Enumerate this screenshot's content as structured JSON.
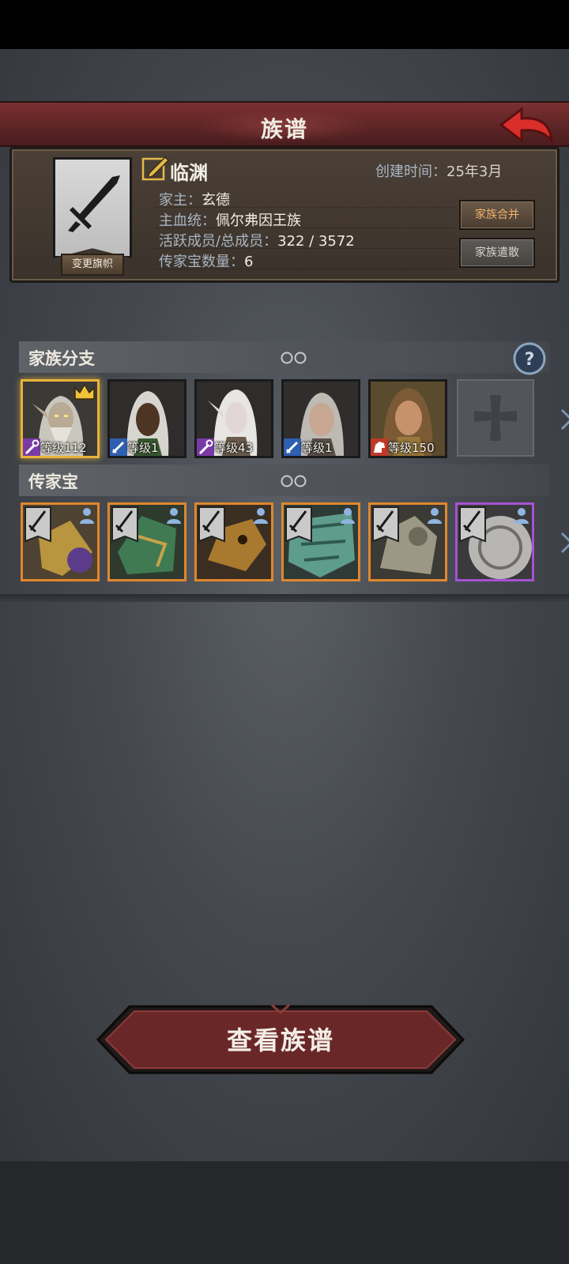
{
  "header": {
    "title": "族谱",
    "back_icon": "back-arrow-icon"
  },
  "family": {
    "banner_button": "变更旗帜",
    "name": "临渊",
    "created_label": "创建时间：",
    "created_value": "25年3月",
    "leader_label": "家主：",
    "leader_value": "玄德",
    "bloodline_label": "主血统：",
    "bloodline_value": "佩尔弗因王族",
    "members_label": "活跃成员/总成员：",
    "members_value": "322 / 3572",
    "heirloom_count_label": "传家宝数量：",
    "heirloom_count_value": "6",
    "merge_button": "家族合并",
    "disband_button": "家族遣散"
  },
  "branches": {
    "title": "家族分支",
    "members": [
      {
        "level_text": "等级112",
        "class_icon": "staff-icon",
        "crown": true,
        "selected": true
      },
      {
        "level_text": "等级1",
        "class_icon": "sword-icon",
        "crown": false,
        "selected": false
      },
      {
        "level_text": "等级43",
        "class_icon": "staff-icon",
        "crown": false,
        "selected": false
      },
      {
        "level_text": "等级1",
        "class_icon": "sword-icon",
        "crown": false,
        "selected": false
      },
      {
        "level_text": "等级150",
        "class_icon": "beast-icon",
        "crown": false,
        "selected": false
      }
    ],
    "empty_slot_icon": "cross-icon"
  },
  "heirlooms": {
    "title": "传家宝",
    "items": [
      {
        "rarity": "orange"
      },
      {
        "rarity": "orange"
      },
      {
        "rarity": "orange"
      },
      {
        "rarity": "orange"
      },
      {
        "rarity": "orange"
      },
      {
        "rarity": "purple"
      }
    ]
  },
  "main_button": "查看族谱",
  "colors": {
    "accent_red": "#6a2728",
    "gold": "#e7b33a",
    "orange": "#e0872d",
    "purple": "#a651d4"
  }
}
